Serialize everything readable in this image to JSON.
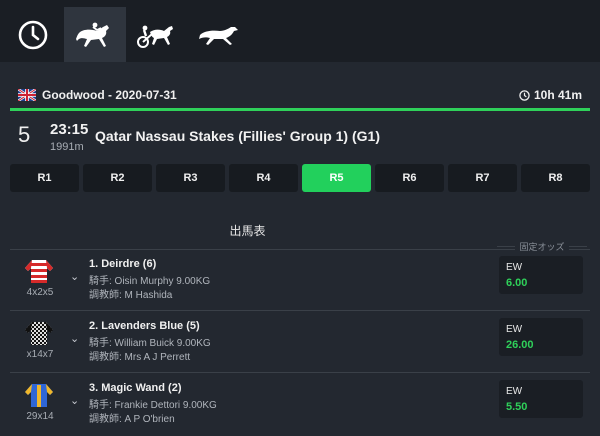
{
  "nav": {
    "tabs": [
      {
        "icon": "clock-icon"
      },
      {
        "icon": "horse-racing-icon",
        "active": true
      },
      {
        "icon": "harness-racing-icon"
      },
      {
        "icon": "greyhound-icon"
      }
    ]
  },
  "event": {
    "flag": "uk-flag-icon",
    "title": "Goodwood - 2020-07-31",
    "countdown": "10h 41m"
  },
  "race": {
    "number": "5",
    "time": "23:15",
    "distance": "1991m",
    "name": "Qatar Nassau Stakes (Fillies' Group 1) (G1)"
  },
  "race_tabs": [
    {
      "label": "R1"
    },
    {
      "label": "R2"
    },
    {
      "label": "R3"
    },
    {
      "label": "R4"
    },
    {
      "label": "R5",
      "active": true
    },
    {
      "label": "R6"
    },
    {
      "label": "R7"
    },
    {
      "label": "R8"
    }
  ],
  "racecard_title": "出馬表",
  "odds_header": "固定オッズ",
  "runners": [
    {
      "silk_code": "4x2x5",
      "name": "1. Deirdre (6)",
      "jockey": "騎手: Oisin Murphy 9.00KG",
      "trainer": "調教師: M Hashida",
      "odds_type": "EW",
      "odds": "6.00"
    },
    {
      "silk_code": "x14x7",
      "name": "2. Lavenders Blue (5)",
      "jockey": "騎手: William Buick 9.00KG",
      "trainer": "調教師: Mrs A J Perrett",
      "odds_type": "EW",
      "odds": "26.00"
    },
    {
      "silk_code": "29x14",
      "name": "3. Magic Wand (2)",
      "jockey": "騎手: Frankie Dettori 9.00KG",
      "trainer": "調教師: A P O'brien",
      "odds_type": "EW",
      "odds": "5.50"
    }
  ],
  "colors": {
    "accent": "#2fd15a",
    "background": "#232830",
    "panel": "#1a1e24"
  }
}
